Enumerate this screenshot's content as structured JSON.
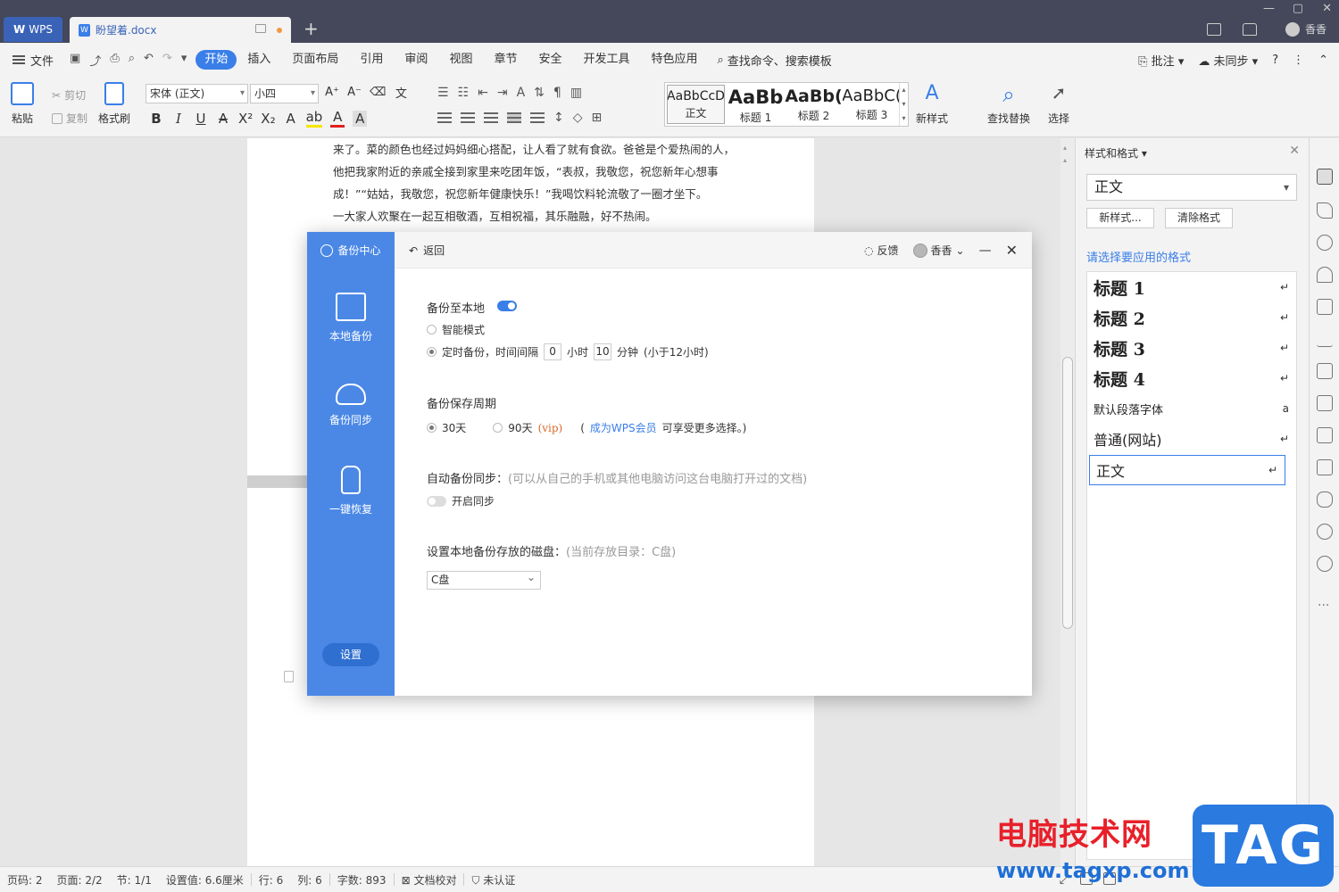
{
  "titlebar": {
    "app_tab": "WPS",
    "doc_tab": "盼望着.docx",
    "user": "香香"
  },
  "menubar": {
    "file": "文件",
    "items": [
      "开始",
      "插入",
      "页面布局",
      "引用",
      "审阅",
      "视图",
      "章节",
      "安全",
      "开发工具",
      "特色应用"
    ],
    "active": "开始",
    "search": "查找命令、搜索模板",
    "right": {
      "comment": "批注",
      "sync": "未同步"
    }
  },
  "ribbon": {
    "paste": "粘贴",
    "cut": "剪切",
    "copy": "复制",
    "format_painter": "格式刷",
    "font_name": "宋体 (正文)",
    "font_size": "小四",
    "styles": [
      {
        "sample": "AaBbCcD",
        "caption": "正文"
      },
      {
        "sample": "AaBb",
        "caption": "标题 1"
      },
      {
        "sample": "AaBb(",
        "caption": "标题 2"
      },
      {
        "sample": "AaBbC(",
        "caption": "标题 3"
      }
    ],
    "new_style": "新样式",
    "find_replace": "查找替换",
    "select": "选择"
  },
  "document": {
    "lines": [
      "来了。菜的颜色也经过妈妈细心搭配，让人看了就有食欲。爸爸是个爱热闹的人，",
      "他把我家附近的亲戚全接到家里来吃团年饭，“表叔，我敬您，祝您新年心想事",
      "成！”“姑姑，我敬您，祝您新年健康快乐！”我喝饮料轮流敬了一圈才坐下。",
      "一大家人欢聚在一起互相敬酒，互相祝福，其乐融融，好不热闹。"
    ]
  },
  "side_panel": {
    "title": "样式和格式",
    "current_style": "正文",
    "new_style_btn": "新样式...",
    "clear_format_btn": "清除格式",
    "hint": "请选择要应用的格式",
    "styles": [
      {
        "name": "标题  1",
        "kind": "heading",
        "mark": "↵"
      },
      {
        "name": "标题  2",
        "kind": "heading",
        "mark": "↵"
      },
      {
        "name": "标题  3",
        "kind": "heading",
        "mark": "↵"
      },
      {
        "name": "标题  4",
        "kind": "heading",
        "mark": "↵"
      },
      {
        "name": "默认段落字体",
        "kind": "small",
        "mark": "a"
      },
      {
        "name": "普通(网站)",
        "kind": "normal",
        "mark": "↵"
      },
      {
        "name": "正文",
        "kind": "normal",
        "mark": "↵",
        "selected": true
      }
    ]
  },
  "dialog": {
    "brand": "备份中心",
    "nav": [
      "本地备份",
      "备份同步",
      "一键恢复"
    ],
    "settings": "设置",
    "back": "返回",
    "feedback": "反馈",
    "user": "香香",
    "local_backup": {
      "title": "备份至本地",
      "enabled": true,
      "smart_mode": "智能模式",
      "timed_prefix": "定时备份，时间间隔",
      "hours": "0",
      "hours_unit": "小时",
      "minutes": "10",
      "minutes_unit": "分钟",
      "limit_note": "(小于12小时)"
    },
    "retention": {
      "title": "备份保存周期",
      "opt_30": "30天",
      "opt_90": "90天",
      "vip": "(vip)",
      "note_open": "(",
      "member_link": "成为WPS会员",
      "note_rest": "可享受更多选择。)",
      "selected": "30天"
    },
    "auto_sync": {
      "title": "自动备份同步：",
      "hint": "(可以从自己的手机或其他电脑访问这台电脑打开过的文档)",
      "toggle_label": "开启同步",
      "enabled": false
    },
    "disk": {
      "title": "设置本地备份存放的磁盘：",
      "hint": "(当前存放目录：C盘)",
      "value": "C盘"
    }
  },
  "statusbar": {
    "page_code": "页码: 2",
    "pages": "页面: 2/2",
    "section": "节: 1/1",
    "setting": "设置值: 6.6厘米",
    "row": "行: 6",
    "col": "列: 6",
    "words": "字数: 893",
    "proof": "文档校对",
    "auth": "未认证"
  },
  "watermark": {
    "cn": "电脑技术网",
    "url": "www.tagxp.com",
    "tag": "TAG"
  },
  "colors": {
    "accent": "#3a7ee8",
    "dialog_sidebar": "#4b88e6",
    "titlebar": "#44485a",
    "watermark_red": "#e8202a"
  }
}
